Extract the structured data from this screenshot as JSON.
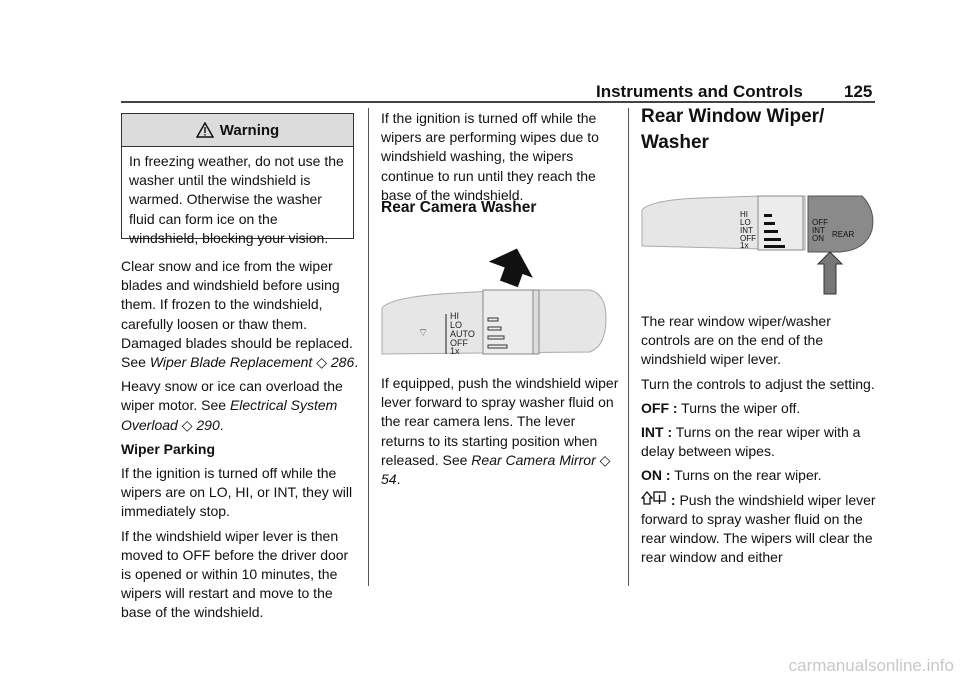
{
  "header": {
    "section": "Instruments and Controls",
    "page": "125"
  },
  "warning": {
    "title": "Warning",
    "icon": "warning-triangle-icon",
    "body": "In freezing weather, do not use the washer until the windshield is warmed. Otherwise the washer fluid can form ice on the windshield, blocking your vision."
  },
  "ref_symbol": "◇",
  "col1": {
    "p1": {
      "text": "Clear snow and ice from the wiper blades and windshield before using them. If frozen to the windshield, carefully loosen or thaw them. Damaged blades should be replaced. See ",
      "link": "Wiper Blade Replacement",
      "page": "286"
    },
    "p2": {
      "text": "Heavy snow or ice can overload the wiper motor. See ",
      "link": "Electrical System Overload",
      "page": "290"
    },
    "subheading": "Wiper Parking",
    "p3": "If the ignition is turned off while the wipers are on LO, HI, or INT, they will immediately stop.",
    "p4": "If the windshield wiper lever is then moved to OFF before the driver door is opened or within 10 minutes, the wipers will restart and move to the base of the windshield."
  },
  "col2": {
    "p1": "If the ignition is turned off while the wipers are performing wipes due to windshield washing, the wipers continue to run until they reach the base of the windshield.",
    "heading": "Rear Camera Washer",
    "figure_labels": [
      "HI",
      "LO",
      "AUTO",
      "OFF",
      "1x"
    ],
    "p2": {
      "text": "If equipped, push the windshield wiper lever forward to spray washer fluid on the rear camera lens. The lever returns to its starting position when released. See ",
      "link": "Rear Camera Mirror",
      "page": "54"
    }
  },
  "col3": {
    "heading": "Rear Window Wiper/ Washer",
    "figure_labels": [
      "HI",
      "LO",
      "INT",
      "OFF",
      "1x",
      "OFF",
      "INT",
      "ON",
      "REAR"
    ],
    "p1": "The rear window wiper/washer controls are on the end of the windshield wiper lever.",
    "p2": "Turn the controls to adjust the setting.",
    "items": [
      {
        "term": "OFF :",
        "desc": " Turns the wiper off."
      },
      {
        "term": "INT :",
        "desc": " Turns on the rear wiper with a delay between wipes."
      },
      {
        "term": "ON :",
        "desc": " Turns on the rear wiper."
      },
      {
        "term": " :",
        "icon": "rear-washer-icon",
        "desc": " Push the windshield wiper lever forward to spray washer fluid on the rear window. The wipers will clear the rear window and either"
      }
    ]
  },
  "watermark": "carmanualsonline.info"
}
